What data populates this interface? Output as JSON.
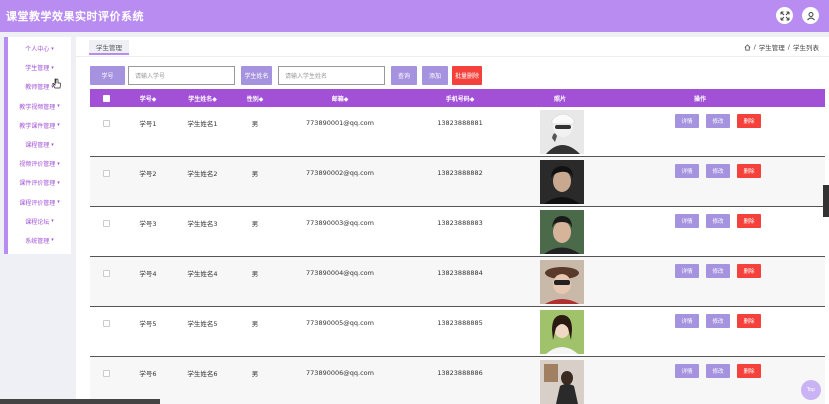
{
  "app": {
    "title": "课堂教学效果实时评价系统"
  },
  "header": {
    "icons": [
      "fullscreen-icon",
      "user-icon"
    ]
  },
  "sidebar": {
    "items": [
      {
        "label": "个人中心"
      },
      {
        "label": "学生管理"
      },
      {
        "label": "教师管理"
      },
      {
        "label": "教学视频管理"
      },
      {
        "label": "教学课件管理"
      },
      {
        "label": "课程管理"
      },
      {
        "label": "视频评价管理"
      },
      {
        "label": "课件评价管理"
      },
      {
        "label": "课程评价管理"
      },
      {
        "label": "课程论坛"
      },
      {
        "label": "系统管理"
      }
    ]
  },
  "tab": {
    "label": "学生管理"
  },
  "breadcrumb": {
    "items": [
      "学生管理",
      "学生列表"
    ],
    "separator": "/"
  },
  "search": {
    "xuehao_label": "学号",
    "xuehao_placeholder": "请输入学号",
    "name_label": "学生姓名",
    "name_placeholder": "请输入学生姓名",
    "query_button": "查询",
    "add_button": "添加",
    "batch_delete_button": "批量删除"
  },
  "table": {
    "headers": [
      "学号◆",
      "学生姓名◆",
      "性别◆",
      "邮箱◆",
      "手机号码◆",
      "照片",
      "操作"
    ],
    "rows": [
      {
        "xuehao": "学号1",
        "name": "学生姓名1",
        "gender": "男",
        "email": "773890001@qq.com",
        "phone": "13823888881"
      },
      {
        "xuehao": "学号2",
        "name": "学生姓名2",
        "gender": "男",
        "email": "773890002@qq.com",
        "phone": "13823888882"
      },
      {
        "xuehao": "学号3",
        "name": "学生姓名3",
        "gender": "男",
        "email": "773890003@qq.com",
        "phone": "13823888883"
      },
      {
        "xuehao": "学号4",
        "name": "学生姓名4",
        "gender": "男",
        "email": "773890004@qq.com",
        "phone": "13823888884"
      },
      {
        "xuehao": "学号5",
        "name": "学生姓名5",
        "gender": "男",
        "email": "773890005@qq.com",
        "phone": "13823888885"
      },
      {
        "xuehao": "学号6",
        "name": "学生姓名6",
        "gender": "男",
        "email": "773890006@qq.com",
        "phone": "13823888886"
      }
    ],
    "actions": {
      "detail": "详情",
      "edit": "修改",
      "delete": "删除"
    }
  },
  "back_to_top": "Top",
  "colors": {
    "header": "#b88cf0",
    "accent": "#a251d6",
    "button": "#a593e0",
    "danger": "#f5413b"
  }
}
